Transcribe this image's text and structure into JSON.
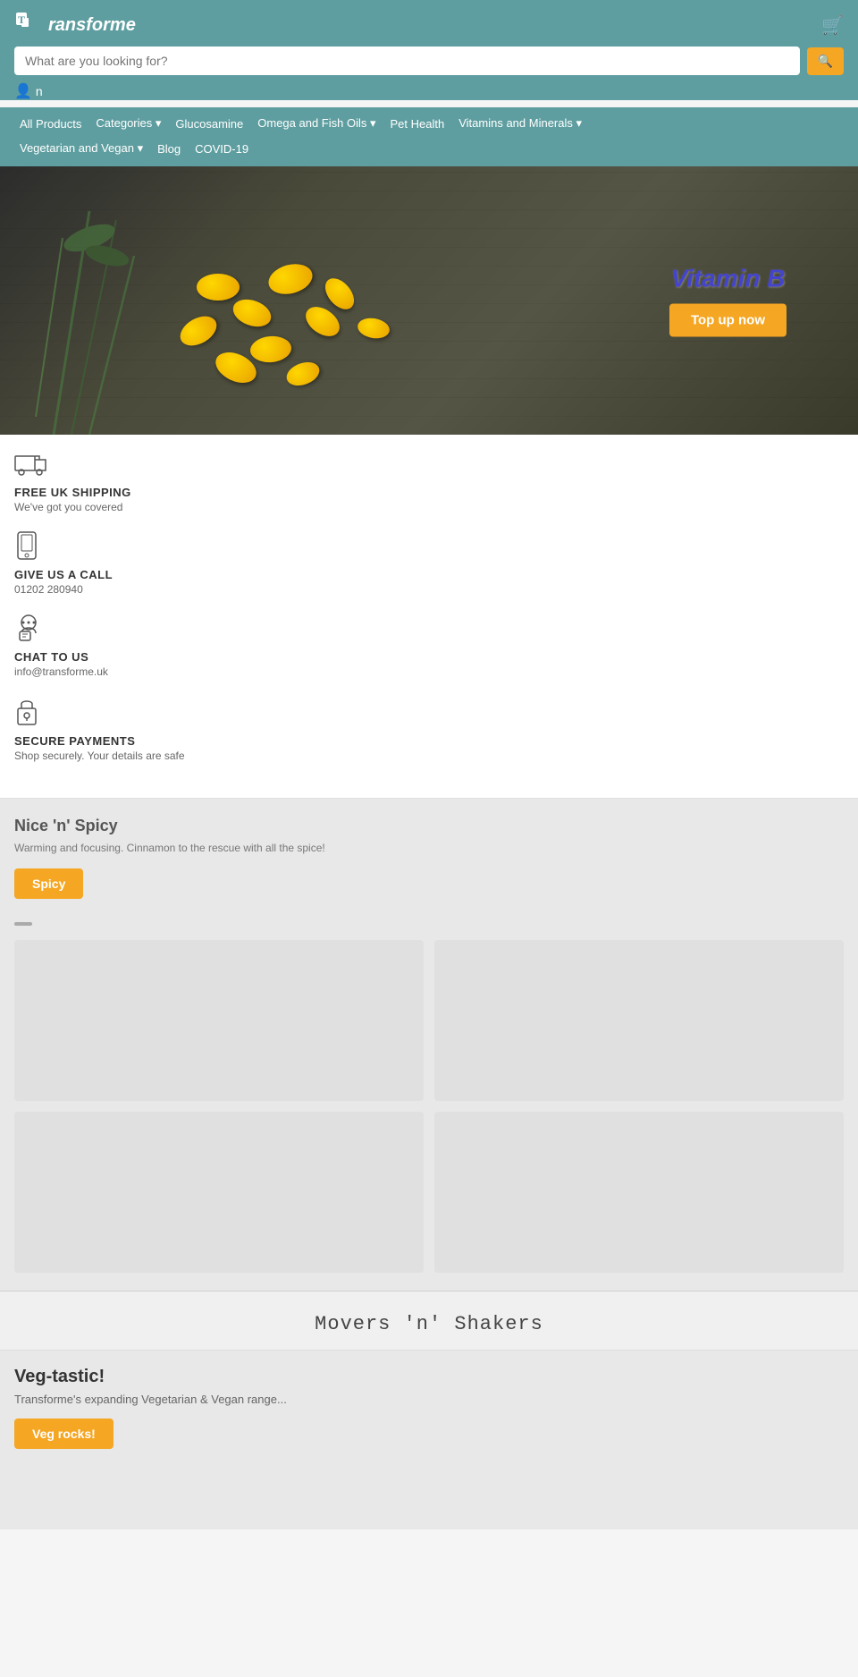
{
  "site": {
    "logo_text": "ransforme",
    "logo_initial": "T"
  },
  "header": {
    "search_placeholder": "What are you looking for?",
    "search_btn_label": "🔍",
    "user_label": "n",
    "cart_icon": "🛒"
  },
  "nav": {
    "items": [
      {
        "label": "All Products",
        "has_dropdown": false
      },
      {
        "label": "Categories",
        "has_dropdown": true
      },
      {
        "label": "Glucosamine",
        "has_dropdown": false
      },
      {
        "label": "Omega and Fish Oils",
        "has_dropdown": true
      },
      {
        "label": "Pet Health",
        "has_dropdown": false
      },
      {
        "label": "Vitamins and Minerals",
        "has_dropdown": true
      },
      {
        "label": "Vegetarian and Vegan",
        "has_dropdown": true
      },
      {
        "label": "Blog",
        "has_dropdown": false
      },
      {
        "label": "COVID-19",
        "has_dropdown": false
      }
    ]
  },
  "hero": {
    "title": "Vitamin B",
    "cta_label": "Top up now"
  },
  "info": [
    {
      "icon": "🚚",
      "title": "FREE UK SHIPPING",
      "text": "We've got you covered"
    },
    {
      "icon": "📱",
      "title": "GIVE US A CALL",
      "text": "01202 280940"
    },
    {
      "icon": "💬",
      "title": "CHAT TO US",
      "text": "info@transforme.uk"
    },
    {
      "icon": "🔒",
      "title": "SECURE PAYMENTS",
      "text": "Shop securely. Your details are safe"
    }
  ],
  "promo1": {
    "title": "Nice 'n' Spicy",
    "description": "Warming and focusing. Cinnamon to the rescue with all the spice!",
    "btn_label": "Spicy"
  },
  "movers": {
    "title": "Movers 'n' Shakers"
  },
  "veg": {
    "title": "Veg-tastic!",
    "description": "Transforme's expanding Vegetarian & Vegan range...",
    "btn_label": "Veg rocks!"
  }
}
